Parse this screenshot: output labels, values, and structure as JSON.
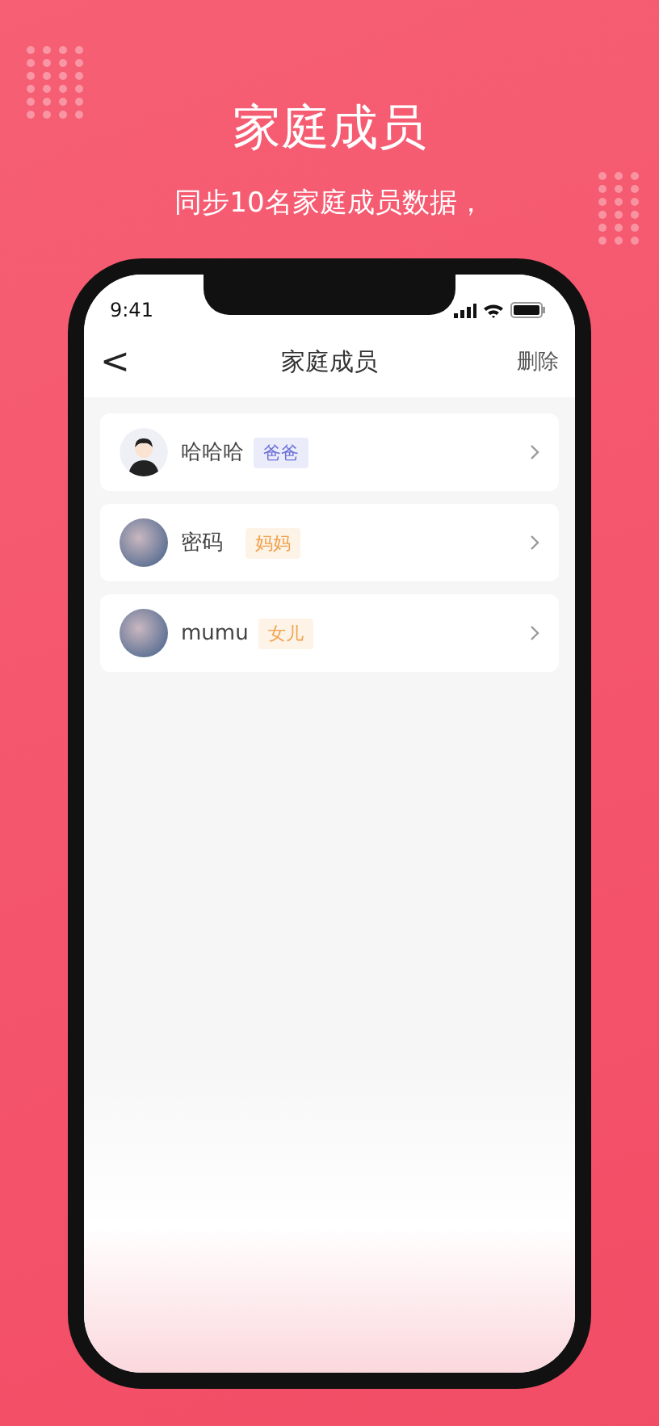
{
  "headline": "家庭成员",
  "subtitle": "同步10名家庭成员数据，",
  "status_bar": {
    "time": "9:41"
  },
  "nav": {
    "back": "<",
    "title": "家庭成员",
    "action": "删除"
  },
  "members": [
    {
      "name": "哈哈哈",
      "tag": "爸爸",
      "color": "#6b70d8",
      "kind": "cartoon"
    },
    {
      "name": "密码",
      "tag": "妈妈",
      "color": "#f0a24e",
      "kind": "photo"
    },
    {
      "name": "mumu",
      "tag": "女儿",
      "color": "#f0a24e",
      "kind": "photo"
    }
  ]
}
